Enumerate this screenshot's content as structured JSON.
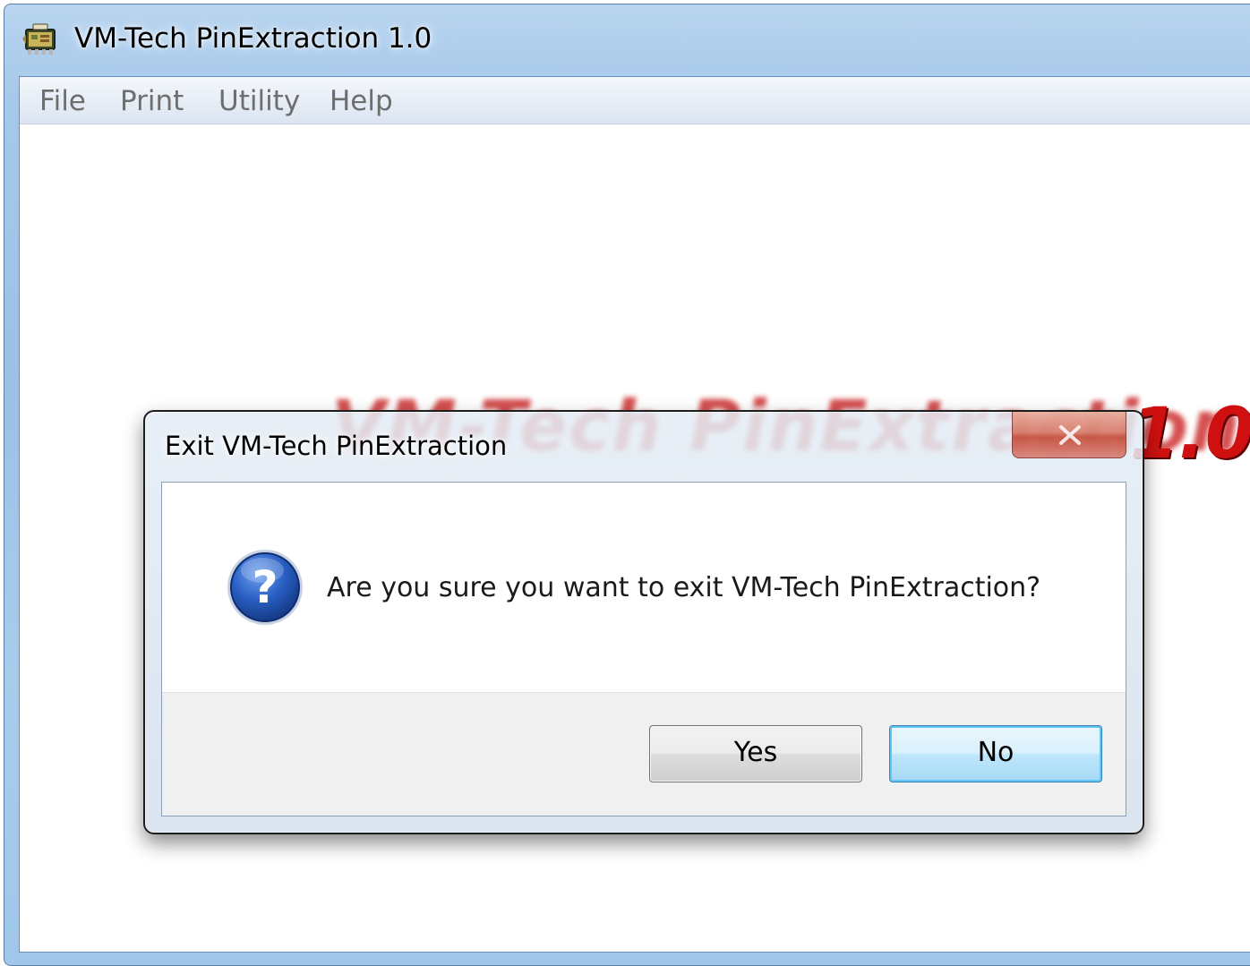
{
  "window": {
    "title": "VM-Tech PinExtraction 1.0",
    "icon": "app-icon"
  },
  "menu": {
    "items": [
      {
        "label": "File"
      },
      {
        "label": "Print"
      },
      {
        "label": "Utility"
      },
      {
        "label": "Help"
      }
    ]
  },
  "background": {
    "banner_text": "VM-Tech PinExtraction",
    "banner_version": "1.0",
    "banner_color": "#c81616"
  },
  "dialog": {
    "title": "Exit VM-Tech PinExtraction",
    "message": "Are you sure you want to exit VM-Tech PinExtraction?",
    "icon": "question-icon",
    "close_icon": "close-icon",
    "buttons": {
      "yes_label": "Yes",
      "no_label": "No",
      "default": "No"
    }
  },
  "colors": {
    "frame": "#a6c8ea",
    "default_button_border": "#3c7fb1",
    "question_icon": "#1f4fa8"
  }
}
